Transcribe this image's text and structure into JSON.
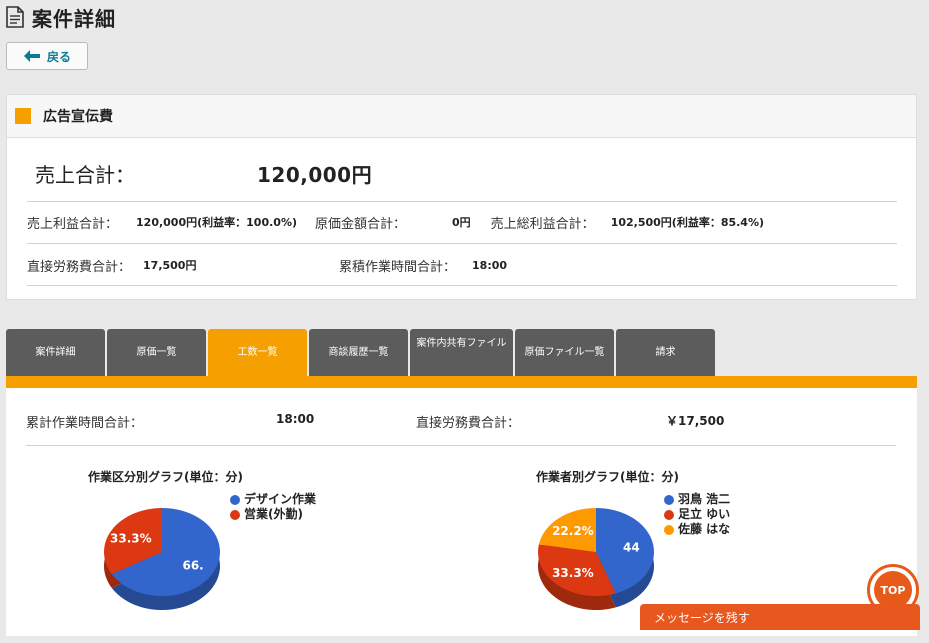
{
  "page": {
    "title": "案件詳細",
    "back_label": "戻る"
  },
  "project": {
    "name": "広告宣伝費",
    "sales_total_label": "売上合計：",
    "sales_total_value": "120,000円",
    "metrics_row1": [
      {
        "label": "売上利益合計：",
        "value": "120,000円(利益率：100.0%)"
      },
      {
        "label": "原価金額合計：",
        "value": "0円"
      },
      {
        "label": "売上総利益合計：",
        "value": "102,500円(利益率：85.4%)"
      }
    ],
    "metrics_row2": [
      {
        "label": "直接労務費合計：",
        "value": "17,500円"
      },
      {
        "label": "累積作業時間合計：",
        "value": "18:00"
      }
    ]
  },
  "tabs": [
    {
      "label": "案件詳細",
      "active": false
    },
    {
      "label": "原価一覧",
      "active": false
    },
    {
      "label": "工数一覧",
      "active": true
    },
    {
      "label": "商談履歴一覧",
      "active": false
    },
    {
      "label": "案件内共有ファイル",
      "active": false
    },
    {
      "label": "原価ファイル一覧",
      "active": false
    },
    {
      "label": "請求",
      "active": false
    }
  ],
  "summary": {
    "hours_label": "累計作業時間合計：",
    "hours_value": "18:00",
    "labor_label": "直接労務費合計：",
    "labor_value": "￥17,500"
  },
  "chart_data": [
    {
      "type": "pie",
      "title": "作業区分別グラフ(単位：分)",
      "series": [
        {
          "name": "デザイン作業",
          "value": 66.7,
          "label": "66.",
          "color": "#3366cc"
        },
        {
          "name": "営業(外勤)",
          "value": 33.3,
          "label": "33.3%",
          "color": "#dc3912"
        }
      ]
    },
    {
      "type": "pie",
      "title": "作業者別グラフ(単位：分)",
      "series": [
        {
          "name": "羽鳥 浩二",
          "value": 44.4,
          "label": "44",
          "color": "#3366cc"
        },
        {
          "name": "足立 ゆい",
          "value": 33.3,
          "label": "33.3%",
          "color": "#dc3912"
        },
        {
          "name": "佐藤 はな",
          "value": 22.2,
          "label": "22.2%",
          "color": "#ff9900"
        }
      ]
    }
  ],
  "widgets": {
    "top_label": "TOP",
    "message_label": "メッセージを残す"
  },
  "colors": {
    "accent": "#f5a000",
    "tab_inactive": "#5c5c5c",
    "message_bar": "#e8571e"
  }
}
